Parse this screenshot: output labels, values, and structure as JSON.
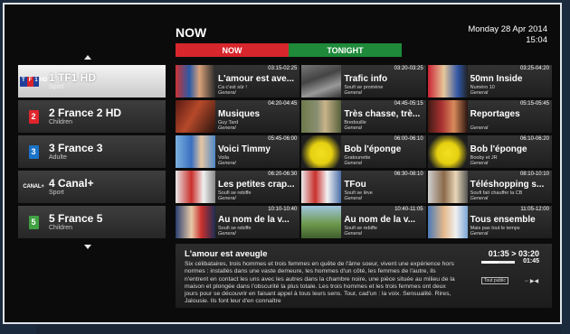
{
  "header": {
    "title": "NOW",
    "date": "Monday 28 Apr 2014",
    "time": "15:04"
  },
  "tabs": [
    {
      "label": "NOW",
      "color": "#d7262c"
    },
    {
      "label": "TONIGHT",
      "color": "#1e8a3a"
    }
  ],
  "channels": [
    {
      "logo": "TF1 HD",
      "name": "1 TF1 HD",
      "genre": "Sport"
    },
    {
      "logo": "2",
      "name": "2 France 2 HD",
      "genre": "Children"
    },
    {
      "logo": "3",
      "name": "3 France 3",
      "genre": "Adulte"
    },
    {
      "logo": "CANAL+",
      "name": "4 Canal+",
      "genre": "Sport"
    },
    {
      "logo": "5",
      "name": "5 France 5",
      "genre": "Children"
    }
  ],
  "grid": [
    [
      {
        "time": "03:15-02:25",
        "title": "L'amour est ave...",
        "subtitle": "Ca c'est sûr !",
        "genre": "General"
      },
      {
        "time": "03:20-03:25",
        "title": "Trafic info",
        "subtitle": "Soufi se promène",
        "genre": "General"
      },
      {
        "time": "03:25-04:20",
        "title": "50mn Inside",
        "subtitle": "Numéro 10",
        "genre": "General"
      }
    ],
    [
      {
        "time": "04:20-04:45",
        "title": "Musiques",
        "subtitle": "Guy Tard",
        "genre": "General"
      },
      {
        "time": "04:45-05:15",
        "title": "Très chasse, trè...",
        "subtitle": "Bredouille",
        "genre": "General"
      },
      {
        "time": "05:15-05:45",
        "title": "Reportages",
        "subtitle": "",
        "genre": "General"
      }
    ],
    [
      {
        "time": "05:45-06:00",
        "title": "Voici Timmy",
        "subtitle": "Voila",
        "genre": "General"
      },
      {
        "time": "06:00-06:10",
        "title": "Bob l'éponge",
        "subtitle": "Gratounette",
        "genre": "General"
      },
      {
        "time": "06:10-06:20",
        "title": "Bob l'éponge",
        "subtitle": "Booby et JR",
        "genre": "General"
      }
    ],
    [
      {
        "time": "06:20-06:30",
        "title": "Les petites crap...",
        "subtitle": "Soufi se rebiffe",
        "genre": "General"
      },
      {
        "time": "06:30-08:10",
        "title": "TFou",
        "subtitle": "Soufi se lève",
        "genre": "General"
      },
      {
        "time": "08:10-10:10",
        "title": "Téléshopping s...",
        "subtitle": "Soufi fait chauffer la CB",
        "genre": "General"
      }
    ],
    [
      {
        "time": "10:10-10:40",
        "title": "Au nom de la v...",
        "subtitle": "Soufi se rebiffe",
        "genre": "General"
      },
      {
        "time": "10:40-11:05",
        "title": "Au nom de la v...",
        "subtitle": "Soufi se rebiffe",
        "genre": "General"
      },
      {
        "time": "11:05-12:00",
        "title": "Tous ensemble",
        "subtitle": "Mais pas tout le temps",
        "genre": "General"
      }
    ]
  ],
  "detail": {
    "title": "L'amour est aveugle",
    "description": "Six célibataires, trois hommes et trois femmes en quête de l'âme soeur, vivent une expérience hors normes : installés dans une vaste demeure, les hommes d'un côté, les femmes de l'autre, ils n'entrent en contact les uns avec les autres dans la chambre noire, une pièce située au milieu de la maison et plongée dans l'obscurité la plus totale. Les trois hommes et les trois femmes ont deux jours pour se découvrir en faisant appel à tous leurs sens. Tour, cad'un : la voix. Sensualité. Rires, Jalousie. Ils font leur d'en connaître",
    "time_range": "01:35 > 03:20",
    "remaining": "01:45",
    "progress": 0.5,
    "badge": "Tout public",
    "icons": "◦◦ ▶◀"
  }
}
